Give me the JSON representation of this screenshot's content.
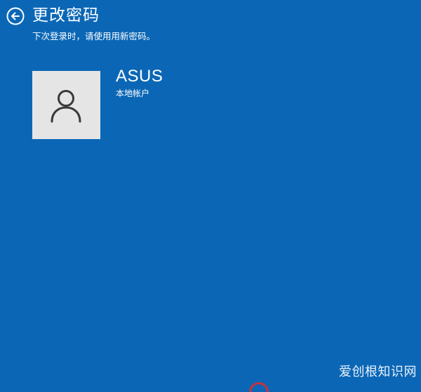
{
  "header": {
    "title": "更改密码",
    "subtitle": "下次登录时，请使用用新密码。",
    "back_icon": "back-arrow-circle-icon"
  },
  "account": {
    "name": "ASUS",
    "type": "本地帐户",
    "avatar_icon": "user-icon"
  },
  "watermark": {
    "text": "爱创根知识网"
  },
  "colors": {
    "background": "#0b67b6",
    "avatar_bg": "#e5e5e5",
    "icon": "#3a3a3a",
    "text": "#ffffff"
  }
}
